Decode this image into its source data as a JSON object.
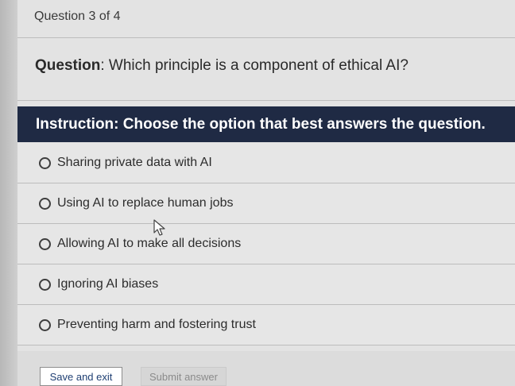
{
  "progress": {
    "text": "Question 3 of 4"
  },
  "question": {
    "label": "Question",
    "separator": ": ",
    "text": "Which principle is a component of ethical AI?"
  },
  "instruction": {
    "text": "Instruction: Choose the option that best answers the question."
  },
  "options": [
    {
      "label": "Sharing private data with AI",
      "selected": false
    },
    {
      "label": "Using AI to replace human jobs",
      "selected": false
    },
    {
      "label": "Allowing AI to make all decisions",
      "selected": false
    },
    {
      "label": "Ignoring AI biases",
      "selected": false
    },
    {
      "label": "Preventing harm and fostering trust",
      "selected": false
    }
  ],
  "buttons": {
    "save_exit": "Save and exit",
    "submit": "Submit answer"
  },
  "colors": {
    "instruction_bar": "#1f2a44",
    "save_text": "#1f3f73"
  },
  "icons": {
    "option_radio": "radio-unchecked-icon",
    "pointer": "mouse-pointer-icon"
  }
}
